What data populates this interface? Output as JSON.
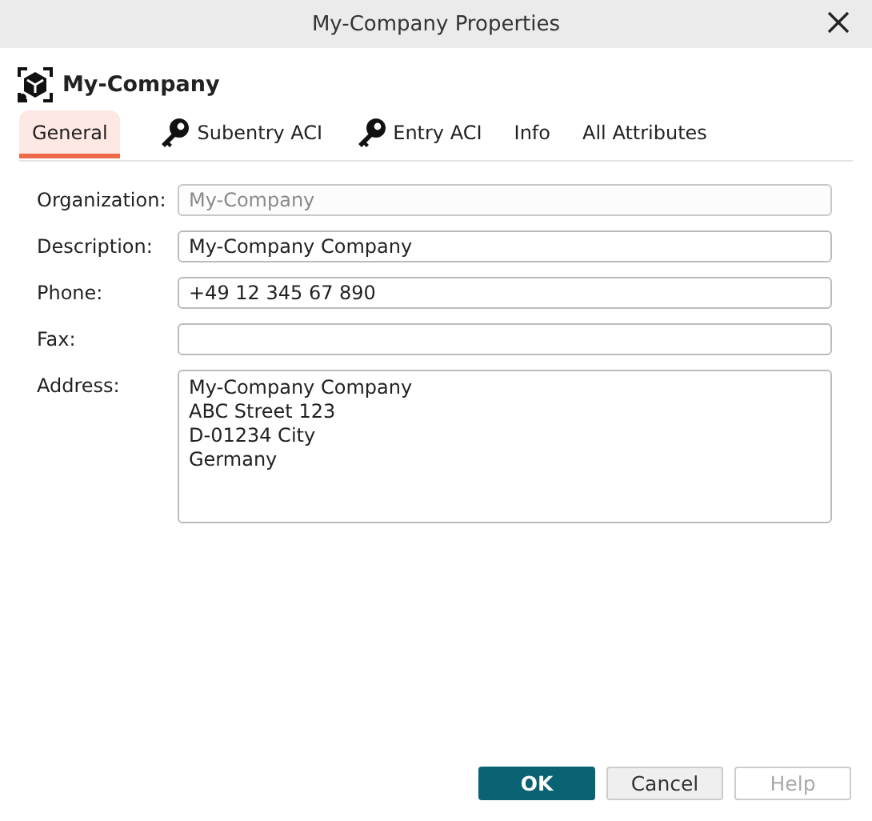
{
  "window": {
    "title": "My-Company Properties"
  },
  "header": {
    "title": "My-Company"
  },
  "tabs": [
    {
      "label": "General",
      "selected": true,
      "kind": "plain"
    },
    {
      "label": "Subentry ACI",
      "selected": false,
      "kind": "key"
    },
    {
      "label": "Entry ACI",
      "selected": false,
      "kind": "key"
    },
    {
      "label": "Info",
      "selected": false,
      "kind": "plain"
    },
    {
      "label": "All Attributes",
      "selected": false,
      "kind": "plain"
    }
  ],
  "fields": [
    {
      "label": "Organization:",
      "value": "My-Company",
      "disabled": true,
      "kind": "line"
    },
    {
      "label": "Description:",
      "value": "My-Company Company",
      "disabled": false,
      "kind": "line"
    },
    {
      "label": "Phone:",
      "value": "+49 12 345 67 890",
      "disabled": false,
      "kind": "line"
    },
    {
      "label": "Fax:",
      "disabled": false,
      "kind": "line"
    },
    {
      "label": "Address:",
      "value": "My-Company Company\nABC Street 123\nD-01234 City\nGermany",
      "disabled": false,
      "kind": "area"
    }
  ],
  "buttons": [
    {
      "label": "OK",
      "kind": "primary",
      "disabled": false
    },
    {
      "label": "Cancel",
      "kind": "normal",
      "disabled": false
    },
    {
      "label": "Help",
      "kind": "normal",
      "disabled": true
    }
  ]
}
